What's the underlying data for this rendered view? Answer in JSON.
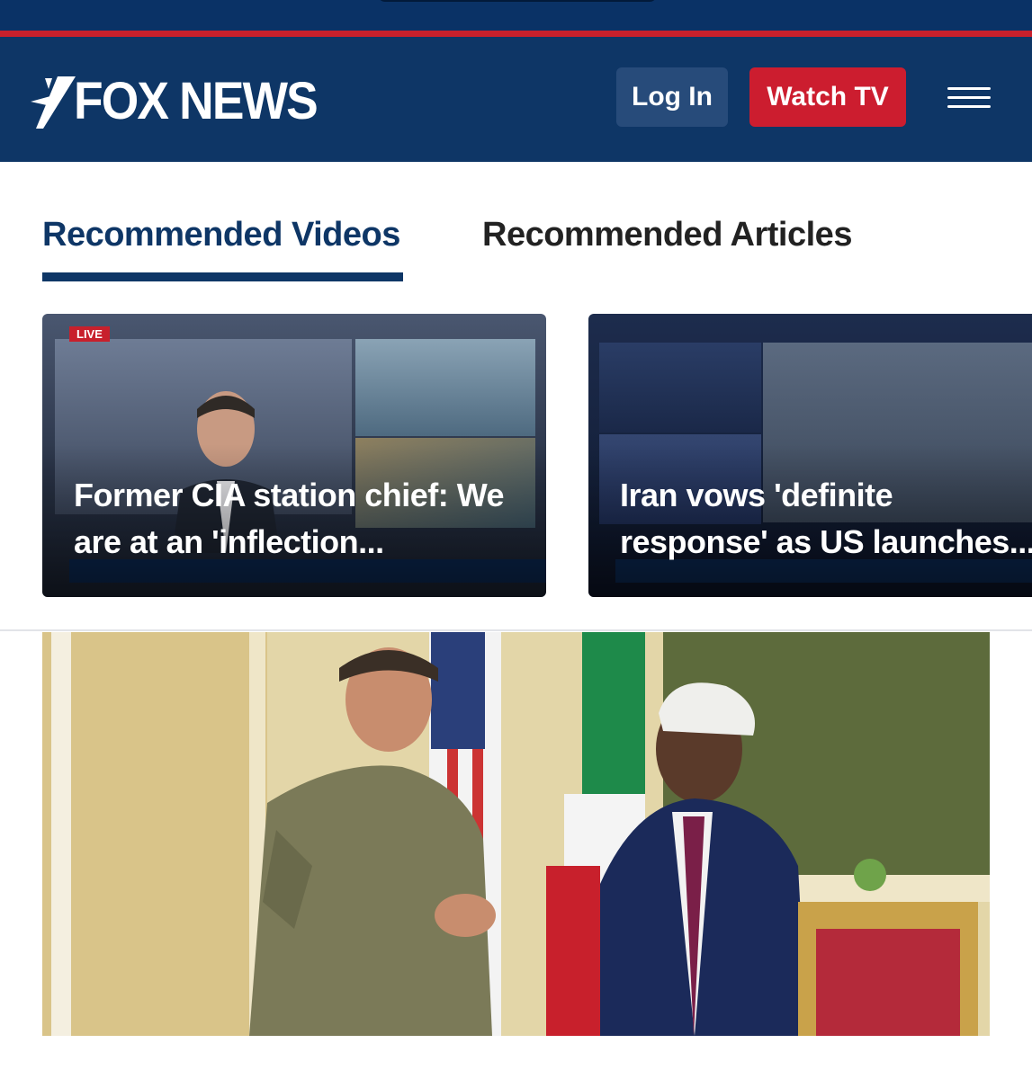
{
  "header": {
    "logo_text": "FOX NEWS",
    "login_label": "Log In",
    "watch_label": "Watch TV",
    "colors": {
      "navy": "#0e3666",
      "red": "#cc1d2f"
    }
  },
  "tabs": [
    {
      "label": "Recommended Videos",
      "active": true
    },
    {
      "label": "Recommended Articles",
      "active": false
    }
  ],
  "videos": [
    {
      "headline": "Former CIA station chief: We are at an 'inflection...",
      "badge": "LIVE"
    },
    {
      "headline": "Iran vows 'definite response' as US launches..."
    }
  ],
  "icons": [
    "fox-news-logo-icon",
    "hamburger-menu-icon"
  ]
}
